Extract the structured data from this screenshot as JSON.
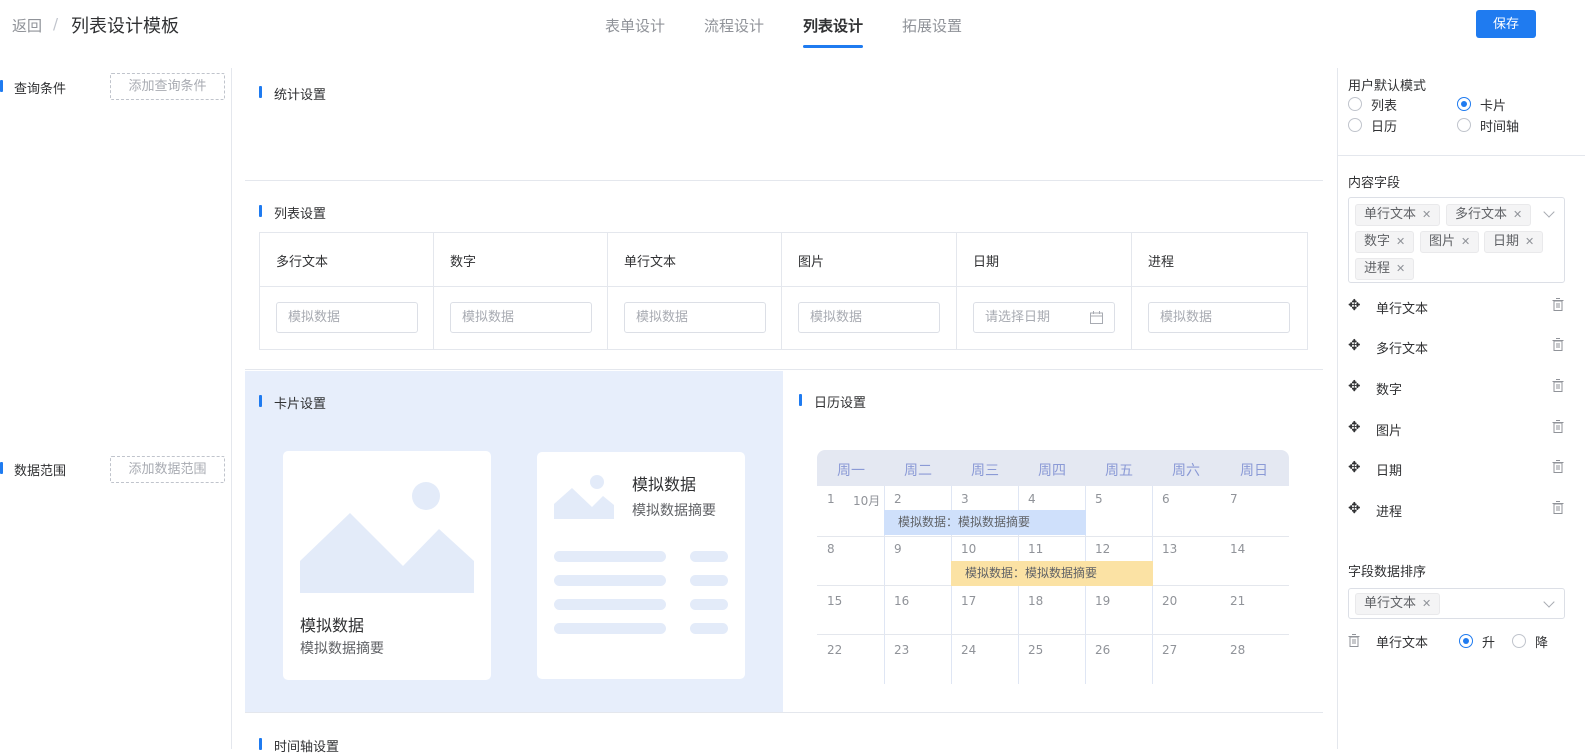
{
  "header": {
    "back": "返回",
    "separator": "/",
    "title": "列表设计模板",
    "tabs": [
      "表单设计",
      "流程设计",
      "列表设计",
      "拓展设置"
    ],
    "active_tab": "列表设计",
    "save": "保存"
  },
  "left": {
    "query_label": "查询条件",
    "query_btn": "添加查询条件",
    "range_label": "数据范围",
    "range_btn": "添加数据范围"
  },
  "sections": {
    "stats": "统计设置",
    "list": "列表设置",
    "card": "卡片设置",
    "calendar": "日历设置",
    "timeline": "时间轴设置"
  },
  "table": {
    "columns": [
      "多行文本",
      "数字",
      "单行文本",
      "图片",
      "日期",
      "进程"
    ],
    "placeholders": [
      "模拟数据",
      "模拟数据",
      "模拟数据",
      "模拟数据",
      "请选择日期",
      "模拟数据"
    ]
  },
  "cards": {
    "title": "模拟数据",
    "summary": "模拟数据摘要"
  },
  "calendar": {
    "weekdays": [
      "周一",
      "周二",
      "周三",
      "周四",
      "周五",
      "周六",
      "周日"
    ],
    "month_label": "10月",
    "weeks": [
      [
        "1",
        "2",
        "3",
        "4",
        "5",
        "6",
        "7"
      ],
      [
        "8",
        "9",
        "10",
        "11",
        "12",
        "13",
        "14"
      ],
      [
        "15",
        "16",
        "17",
        "18",
        "19",
        "20",
        "21"
      ],
      [
        "22",
        "23",
        "24",
        "25",
        "26",
        "27",
        "28"
      ]
    ],
    "event1": "模拟数据：模拟数据摘要",
    "event2": "模拟数据：模拟数据摘要",
    "colors": {
      "event1": "#cfe0fb",
      "event2": "#fbe2a4"
    }
  },
  "right": {
    "mode_label": "用户默认模式",
    "modes": [
      "列表",
      "卡片",
      "日历",
      "时间轴"
    ],
    "selected_mode": "卡片",
    "content_label": "内容字段",
    "content_tags": [
      "单行文本",
      "多行文本",
      "数字",
      "图片",
      "日期",
      "进程"
    ],
    "fields": [
      "单行文本",
      "多行文本",
      "数字",
      "图片",
      "日期",
      "进程"
    ],
    "sort_label": "字段数据排序",
    "sort_tags": [
      "单行文本"
    ],
    "sort_field": "单行文本",
    "asc": "升",
    "desc": "降",
    "sort_selected": "升"
  },
  "colors": {
    "accent": "#1f7bf0"
  }
}
